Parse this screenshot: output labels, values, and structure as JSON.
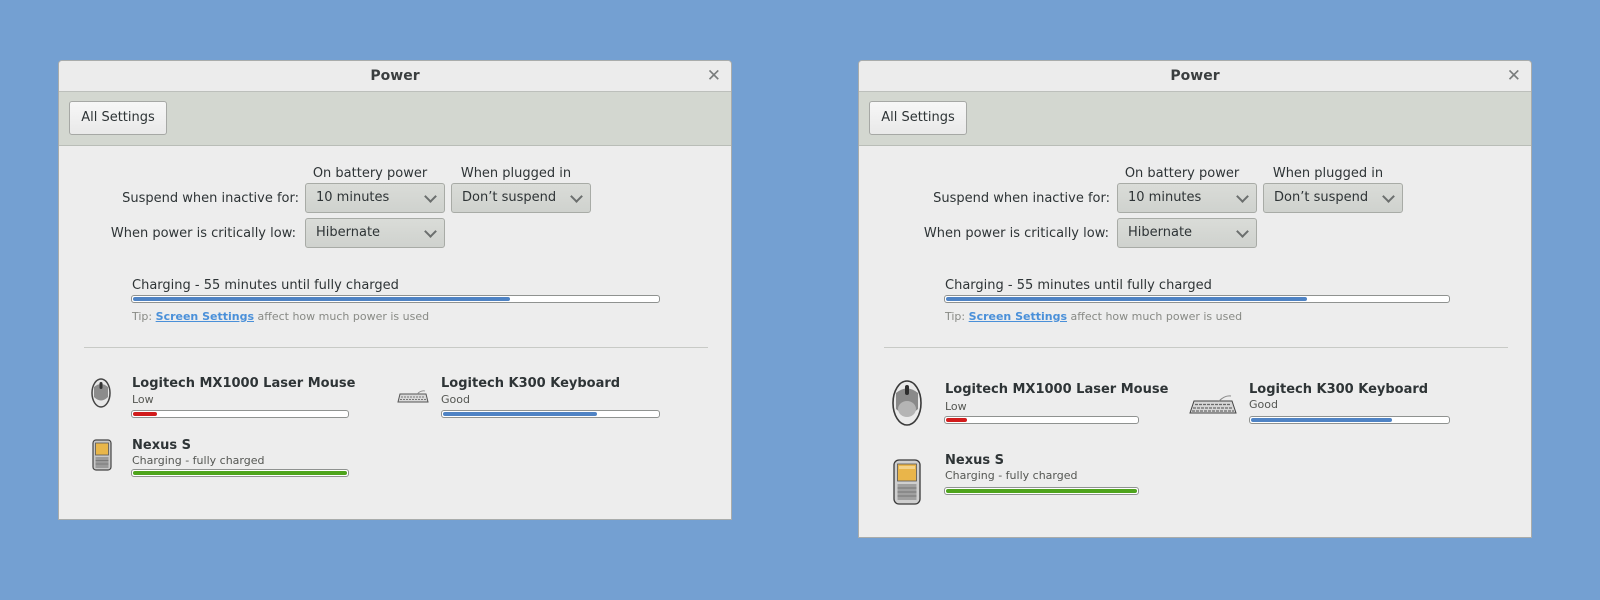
{
  "window": {
    "title": "Power",
    "close_glyph": "✕",
    "all_settings_label": "All Settings"
  },
  "settings": {
    "col_battery": "On battery power",
    "col_plugged": "When plugged in",
    "suspend_label": "Suspend when inactive for:",
    "suspend_battery": "10 minutes",
    "suspend_plugged": "Don’t suspend",
    "critical_label": "When power is critically low:",
    "critical_value": "Hibernate"
  },
  "battery": {
    "status": "Charging - 55 minutes until fully charged",
    "level": 0.72
  },
  "tip": {
    "prefix": "Tip:",
    "link": "Screen Settings",
    "suffix": "affect how much power is used"
  },
  "devices": {
    "mouse": {
      "name": "Logitech MX1000 Laser Mouse",
      "status": "Low",
      "level": 0.12,
      "icon": "mouse-icon"
    },
    "keyboard": {
      "name": "Logitech K300 Keyboard",
      "status": "Good",
      "level": 0.72,
      "icon": "keyboard-icon"
    },
    "phone": {
      "name": "Nexus S",
      "status": "Charging - fully charged",
      "level": 1.0,
      "icon": "phone-icon"
    }
  },
  "colors": {
    "desktop": "#74a0d2",
    "good": "#4f83c4",
    "low": "#d11b1b",
    "full": "#4ea41c"
  }
}
